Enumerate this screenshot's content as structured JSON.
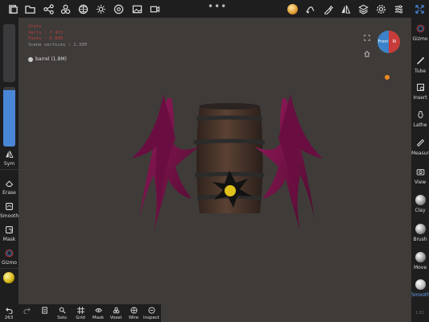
{
  "top_toolbar": {
    "items": [
      {
        "name": "files-icon"
      },
      {
        "name": "folder-icon"
      },
      {
        "name": "share-icon"
      },
      {
        "name": "scene-icon"
      },
      {
        "name": "grid-globe-icon"
      },
      {
        "name": "sun-icon"
      },
      {
        "name": "material-icon"
      },
      {
        "name": "image-icon"
      },
      {
        "name": "video-icon"
      }
    ],
    "right_items": [
      {
        "name": "matcap-icon"
      },
      {
        "name": "stroke-icon"
      },
      {
        "name": "brush-settings-icon"
      },
      {
        "name": "symmetry-icon"
      },
      {
        "name": "layers-icon"
      },
      {
        "name": "settings-icon"
      },
      {
        "name": "menu-icon"
      },
      {
        "name": "fullscreen-icon"
      }
    ]
  },
  "left_panel": {
    "radius_level": 0.95,
    "items": [
      {
        "label": "Sym",
        "icon": "symmetry-icon"
      },
      {
        "label": "Erase",
        "icon": "eraser-icon"
      },
      {
        "label": "Smooth",
        "icon": "smooth-icon"
      },
      {
        "label": "Mask",
        "icon": "mask-icon"
      },
      {
        "label": "Gizmo",
        "icon": "gizmo-icon"
      }
    ]
  },
  "right_panel": {
    "items": [
      {
        "label": "Gizmo",
        "icon": "gizmo-icon"
      },
      {
        "label": "Tube",
        "icon": "tube-icon"
      },
      {
        "label": "Insert",
        "icon": "insert-icon"
      },
      {
        "label": "Lathe",
        "icon": "lathe-icon"
      },
      {
        "label": "Measure",
        "icon": "measure-icon"
      },
      {
        "label": "View",
        "icon": "camera-icon"
      },
      {
        "label": "Clay",
        "icon": "clay-sphere-icon"
      },
      {
        "label": "Brush",
        "icon": "brush-sphere-icon"
      },
      {
        "label": "Move",
        "icon": "move-sphere-icon"
      },
      {
        "label": "Smooth",
        "icon": "smooth-sphere-icon",
        "active": true
      }
    ],
    "version": "1.81"
  },
  "bottom_bar": {
    "undo_count": "263",
    "items": [
      {
        "label": "Solo",
        "icon": "solo-icon"
      },
      {
        "label": "Grid",
        "icon": "grid-icon"
      },
      {
        "label": "Mask",
        "icon": "mask-icon"
      },
      {
        "label": "Voxel",
        "icon": "voxel-icon"
      },
      {
        "label": "Wire",
        "icon": "wire-icon"
      },
      {
        "label": "Inspect",
        "icon": "inspect-icon"
      }
    ]
  },
  "viewport": {
    "stats": [
      "Stats",
      "Verts : 7 473",
      "Faces : 6 888"
    ],
    "scene_vertices": "Scene vertices : 2.35M",
    "mesh_name": "barrel (1.8M)",
    "gizmo_labels": {
      "front": "Front",
      "side": "Ri"
    }
  },
  "colors": {
    "accent": "#4a86d6",
    "background": "#3f3b39",
    "panel": "#1e1e1f",
    "tentacle": "#7b0f4a",
    "barrel_wood": "#4a3429",
    "barrel_band": "#2b2b2b",
    "sphere": "#e0c21c"
  }
}
